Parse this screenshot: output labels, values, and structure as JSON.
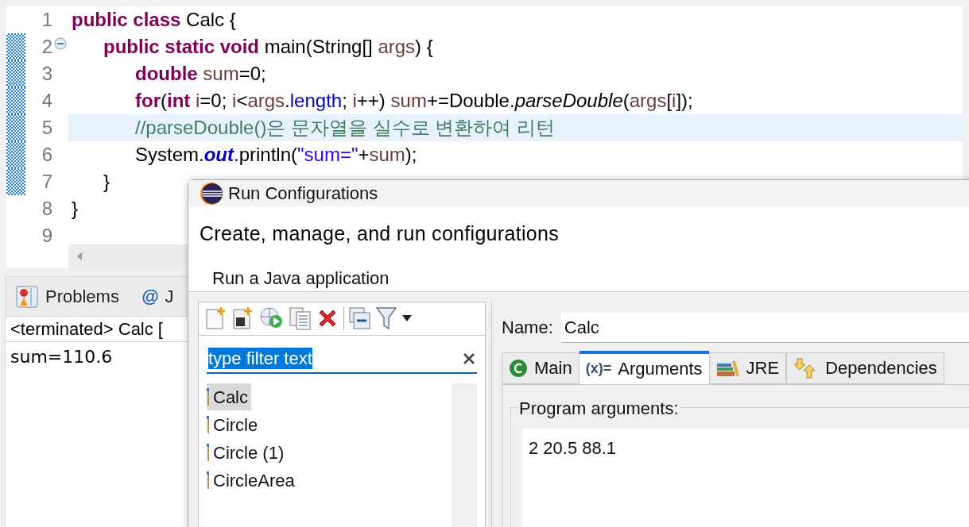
{
  "editor": {
    "lines": [
      {
        "number": "1",
        "changed": false,
        "current": false,
        "tokens": [
          {
            "kind": "keyword",
            "text": "public class"
          },
          {
            "kind": "plain",
            "text": " Calc {"
          }
        ]
      },
      {
        "number": "2",
        "changed": true,
        "foldable": true,
        "current": false,
        "tokens": [
          {
            "kind": "keyword",
            "text": "\tpublic static void"
          },
          {
            "kind": "plain",
            "text": " main(String[] "
          },
          {
            "kind": "local",
            "text": "args"
          },
          {
            "kind": "plain",
            "text": ") {"
          }
        ]
      },
      {
        "number": "3",
        "changed": true,
        "current": false,
        "tokens": [
          {
            "kind": "keyword",
            "text": "\t\tdouble"
          },
          {
            "kind": "local",
            "text": " sum"
          },
          {
            "kind": "plain",
            "text": "=0;"
          }
        ]
      },
      {
        "number": "4",
        "changed": true,
        "current": false,
        "tokens": [
          {
            "kind": "keyword",
            "text": "\t\tfor"
          },
          {
            "kind": "plain",
            "text": "("
          },
          {
            "kind": "keyword",
            "text": "int"
          },
          {
            "kind": "local",
            "text": " i"
          },
          {
            "kind": "plain",
            "text": "=0; "
          },
          {
            "kind": "local",
            "text": "i"
          },
          {
            "kind": "plain",
            "text": "<"
          },
          {
            "kind": "local",
            "text": "args"
          },
          {
            "kind": "plain",
            "text": "."
          },
          {
            "kind": "field",
            "text": "length"
          },
          {
            "kind": "plain",
            "text": "; "
          },
          {
            "kind": "local",
            "text": "i"
          },
          {
            "kind": "plain",
            "text": "++) "
          },
          {
            "kind": "local",
            "text": "sum"
          },
          {
            "kind": "plain",
            "text": "+=Double."
          },
          {
            "kind": "static_method",
            "text": "parseDouble"
          },
          {
            "kind": "plain",
            "text": "("
          },
          {
            "kind": "local",
            "text": "args"
          },
          {
            "kind": "plain",
            "text": "["
          },
          {
            "kind": "local",
            "text": "i"
          },
          {
            "kind": "plain",
            "text": "]);"
          }
        ]
      },
      {
        "number": "5",
        "changed": true,
        "current": true,
        "tokens": [
          {
            "kind": "comment",
            "text": "\t\t//parseDouble()은 문자열을 실수로 변환하여 리턴"
          }
        ]
      },
      {
        "number": "6",
        "changed": true,
        "current": false,
        "tokens": [
          {
            "kind": "plain",
            "text": "\t\tSystem."
          },
          {
            "kind": "static_field",
            "text": "out"
          },
          {
            "kind": "plain",
            "text": ".println("
          },
          {
            "kind": "string",
            "text": "\"sum=\""
          },
          {
            "kind": "plain",
            "text": "+"
          },
          {
            "kind": "local",
            "text": "sum"
          },
          {
            "kind": "plain",
            "text": ");"
          }
        ]
      },
      {
        "number": "7",
        "changed": true,
        "current": false,
        "tokens": [
          {
            "kind": "plain",
            "text": "\t}"
          }
        ]
      },
      {
        "number": "8",
        "changed": false,
        "current": false,
        "tokens": [
          {
            "kind": "plain",
            "text": "}"
          }
        ]
      },
      {
        "number": "9",
        "changed": false,
        "current": false
      }
    ]
  },
  "bottom_panel": {
    "tabs": [
      {
        "label": "Problems",
        "kind": "problems",
        "selected": false
      },
      {
        "label": "J",
        "kind": "javadoc",
        "icon_text": "@",
        "selected": false
      }
    ],
    "console_header": "<terminated> Calc [",
    "console_output": "sum=110.6"
  },
  "dialog": {
    "title": "Run Configurations",
    "heading": "Create, manage, and run configurations",
    "message": "Run a Java application",
    "filter": {
      "value": "type filter text",
      "text_selected": true
    },
    "configurations": [
      {
        "label": "Calc",
        "selected": true
      },
      {
        "label": "Circle",
        "selected": false
      },
      {
        "label": "Circle (1)",
        "selected": false
      },
      {
        "label": "CircleArea",
        "selected": false
      }
    ],
    "name_label": "Name:",
    "name_value": "Calc",
    "tabs": [
      {
        "label": "Main",
        "kind": "main",
        "selected": false
      },
      {
        "label": "Arguments",
        "kind": "arguments",
        "icon_text": "(x)=",
        "selected": true
      },
      {
        "label": "JRE",
        "kind": "jre",
        "selected": false
      },
      {
        "label": "Dependencies",
        "kind": "dependencies",
        "selected": false
      }
    ],
    "program_arguments_label": "Program arguments:",
    "program_arguments": "2 20.5 88.1"
  }
}
